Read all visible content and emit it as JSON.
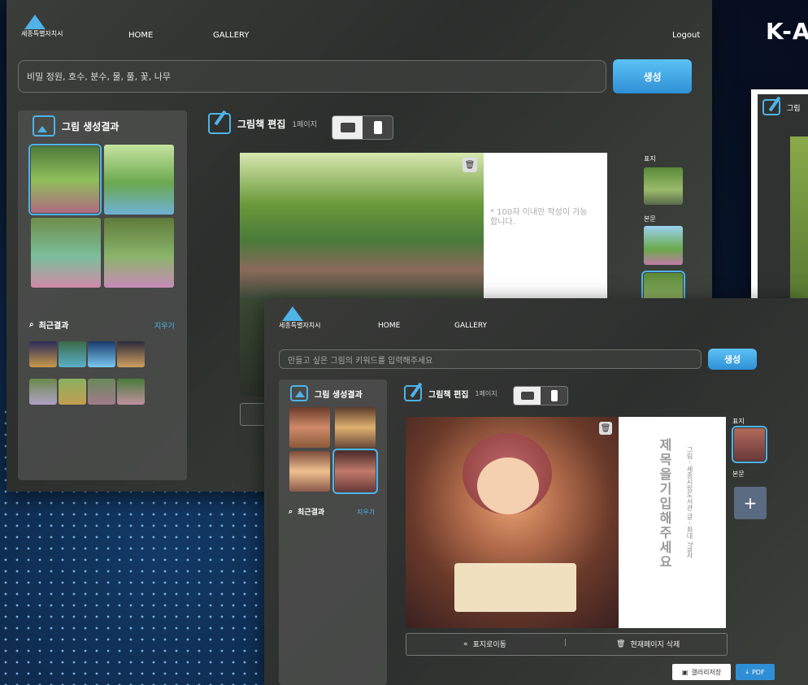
{
  "headline": "K-A",
  "window1": {
    "logo_text": "세종특별자치시",
    "nav": {
      "home": "HOME",
      "gallery": "GALLERY",
      "logout": "Logout"
    },
    "search_value": "비밀 정원, 호수, 분수, 물, 풀, 꽃, 나무",
    "generate_label": "생성",
    "results_title": "그림 생성결과",
    "editor_title": "그림책 편집",
    "page_label": "1페이지",
    "placeholder_text": "* 100자 이내만 작성이 가능합니다.",
    "recent_label": "최근결과",
    "clear_label": "지우기",
    "cover_label": "표지",
    "body_label": "본문"
  },
  "window2": {
    "logo_text": "세종특별자치시",
    "nav": {
      "home": "HOME",
      "gallery": "GALLERY"
    },
    "search_placeholder": "만들고 싶은 그림의 키워드를 입력해주세요",
    "generate_label": "생성",
    "results_title": "그림 생성결과",
    "editor_title": "그림책 편집",
    "page_label": "1페이지",
    "title_placeholder": "제목을기입해주세요",
    "author_text": "그림 - 세종시립도서관   글 - 최대 7글자",
    "recent_label": "최근결과",
    "clear_label": "지우기",
    "cover_label": "표지",
    "body_label": "본문",
    "add_label": "+",
    "move_cover_label": "표지로이동",
    "delete_page_label": "현재페이지 삭제",
    "divider": "|",
    "save_gallery_label": "갤러리저장",
    "pdf_label": "PDF"
  },
  "window3": {
    "title": "그림"
  },
  "icons": {
    "trash": "trash-icon",
    "search": "search-icon",
    "chevrons": "double-chevron-left-icon"
  }
}
